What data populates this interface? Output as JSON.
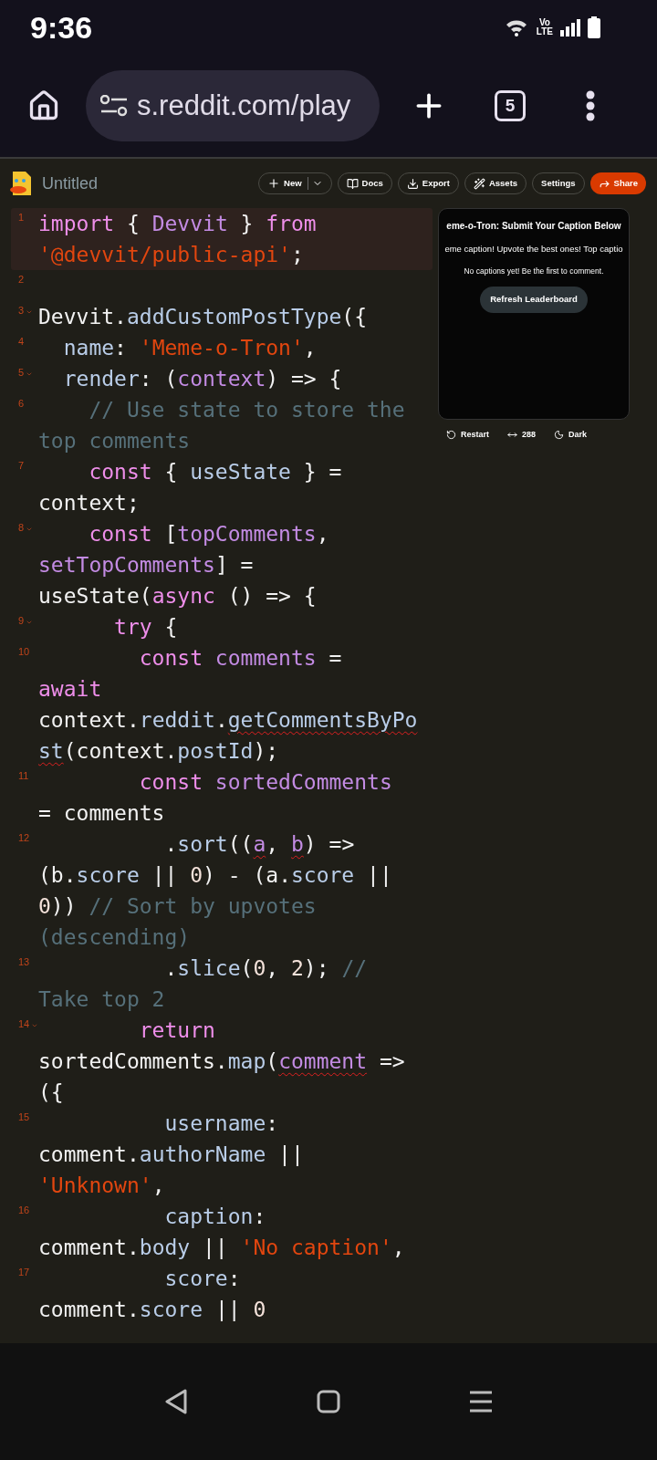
{
  "status_bar": {
    "time": "9:36",
    "network_top": "Vo",
    "network_bottom": "LTE"
  },
  "browser": {
    "url": "s.reddit.com/play",
    "tab_count": "5"
  },
  "app_bar": {
    "title": "Untitled",
    "buttons": [
      {
        "label": "New",
        "kind": "new"
      },
      {
        "label": "Docs",
        "kind": "docs"
      },
      {
        "label": "Export",
        "kind": "export"
      },
      {
        "label": "Assets",
        "kind": "assets"
      },
      {
        "label": "Settings",
        "kind": "settings"
      },
      {
        "label": "Share",
        "kind": "share"
      }
    ]
  },
  "editor": {
    "lines": [
      {
        "number": "1",
        "foldable": false,
        "highlighted": true,
        "wrapped_lines": [
          {
            "segments": [
              {
                "text": "import",
                "kind": "keyword"
              },
              {
                "text": " { ",
                "kind": "plain"
              },
              {
                "text": "Devvit",
                "kind": "variable"
              },
              {
                "text": " } ",
                "kind": "plain"
              },
              {
                "text": "from",
                "kind": "keyword"
              }
            ]
          },
          {
            "segments": [
              {
                "text": "'@devvit/public-api'",
                "kind": "string"
              },
              {
                "text": ";",
                "kind": "plain"
              }
            ]
          }
        ]
      },
      {
        "number": "2",
        "foldable": false,
        "highlighted": false
      },
      {
        "number": "3",
        "foldable": true,
        "highlighted": false,
        "wrapped_lines": [
          {
            "segments": [
              {
                "text": "Devvit.",
                "kind": "plain"
              },
              {
                "text": "addCustomPostType",
                "kind": "property"
              },
              {
                "text": "({",
                "kind": "plain"
              }
            ]
          }
        ]
      },
      {
        "number": "4",
        "foldable": false,
        "highlighted": false,
        "wrapped_lines": [
          {
            "segments": [
              {
                "text": "  name",
                "kind": "property"
              },
              {
                "text": ": ",
                "kind": "plain"
              },
              {
                "text": "'Meme-o-Tron'",
                "kind": "string"
              },
              {
                "text": ",",
                "kind": "plain"
              }
            ]
          }
        ]
      },
      {
        "number": "5",
        "foldable": true,
        "highlighted": false,
        "wrapped_lines": [
          {
            "segments": [
              {
                "text": "  render",
                "kind": "property"
              },
              {
                "text": ": (",
                "kind": "plain"
              },
              {
                "text": "context",
                "kind": "variable"
              },
              {
                "text": ") => {",
                "kind": "plain"
              }
            ]
          }
        ]
      },
      {
        "number": "6",
        "foldable": false,
        "highlighted": false,
        "wrapped_lines": [
          {
            "segments": [
              {
                "text": "    // Use state to store the",
                "kind": "comment"
              }
            ]
          },
          {
            "segments": [
              {
                "text": "top comments",
                "kind": "comment"
              }
            ]
          }
        ]
      },
      {
        "number": "7",
        "foldable": false,
        "highlighted": false,
        "wrapped_lines": [
          {
            "segments": [
              {
                "text": "    const",
                "kind": "keyword"
              },
              {
                "text": " { ",
                "kind": "plain"
              },
              {
                "text": "useState",
                "kind": "property"
              },
              {
                "text": " } =",
                "kind": "plain"
              }
            ]
          },
          {
            "segments": [
              {
                "text": "context;",
                "kind": "plain"
              }
            ]
          }
        ]
      },
      {
        "number": "8",
        "foldable": true,
        "highlighted": false,
        "wrapped_lines": [
          {
            "segments": [
              {
                "text": "    const",
                "kind": "keyword"
              },
              {
                "text": " [",
                "kind": "plain"
              },
              {
                "text": "topComments",
                "kind": "variable"
              },
              {
                "text": ",",
                "kind": "plain"
              }
            ]
          },
          {
            "segments": [
              {
                "text": "setTopComments",
                "kind": "variable"
              },
              {
                "text": "] =",
                "kind": "plain"
              }
            ]
          },
          {
            "segments": [
              {
                "text": "useState(",
                "kind": "plain"
              },
              {
                "text": "async",
                "kind": "keyword"
              },
              {
                "text": " () => {",
                "kind": "plain"
              }
            ]
          }
        ]
      },
      {
        "number": "9",
        "foldable": true,
        "highlighted": false,
        "wrapped_lines": [
          {
            "segments": [
              {
                "text": "      try",
                "kind": "keyword"
              },
              {
                "text": " {",
                "kind": "plain"
              }
            ]
          }
        ]
      },
      {
        "number": "10",
        "foldable": false,
        "highlighted": false,
        "wrapped_lines": [
          {
            "segments": [
              {
                "text": "        const",
                "kind": "keyword"
              },
              {
                "text": " comments",
                "kind": "variable"
              },
              {
                "text": " =",
                "kind": "plain"
              }
            ]
          },
          {
            "segments": [
              {
                "text": "await",
                "kind": "keyword"
              }
            ]
          },
          {
            "segments": [
              {
                "text": "context.",
                "kind": "plain"
              },
              {
                "text": "reddit",
                "kind": "property"
              },
              {
                "text": ".",
                "kind": "plain"
              },
              {
                "text": "getCommentsByPo",
                "kind": "property",
                "underlined": true
              }
            ]
          },
          {
            "segments": [
              {
                "text": "st",
                "kind": "property",
                "underlined": true
              },
              {
                "text": "(context.",
                "kind": "plain"
              },
              {
                "text": "postId",
                "kind": "property"
              },
              {
                "text": ");",
                "kind": "plain"
              }
            ]
          }
        ]
      },
      {
        "number": "11",
        "foldable": false,
        "highlighted": false,
        "wrapped_lines": [
          {
            "segments": [
              {
                "text": "        const",
                "kind": "keyword"
              },
              {
                "text": " sortedComments",
                "kind": "variable"
              }
            ]
          },
          {
            "segments": [
              {
                "text": "= comments",
                "kind": "plain"
              }
            ]
          }
        ]
      },
      {
        "number": "12",
        "foldable": false,
        "highlighted": false,
        "wrapped_lines": [
          {
            "segments": [
              {
                "text": "          .",
                "kind": "plain"
              },
              {
                "text": "sort",
                "kind": "property"
              },
              {
                "text": "((",
                "kind": "plain"
              },
              {
                "text": "a",
                "kind": "variable",
                "underlined": true
              },
              {
                "text": ", ",
                "kind": "plain"
              },
              {
                "text": "b",
                "kind": "variable",
                "underlined": true
              },
              {
                "text": ") =>",
                "kind": "plain"
              }
            ]
          },
          {
            "segments": [
              {
                "text": "(b.",
                "kind": "plain"
              },
              {
                "text": "score",
                "kind": "property"
              },
              {
                "text": " || ",
                "kind": "plain"
              },
              {
                "text": "0",
                "kind": "number"
              },
              {
                "text": ") - (a.",
                "kind": "plain"
              },
              {
                "text": "score",
                "kind": "property"
              },
              {
                "text": " ||",
                "kind": "plain"
              }
            ]
          },
          {
            "segments": [
              {
                "text": "0",
                "kind": "number"
              },
              {
                "text": ")) ",
                "kind": "plain"
              },
              {
                "text": "// Sort by upvotes",
                "kind": "comment"
              }
            ]
          },
          {
            "segments": [
              {
                "text": "(descending)",
                "kind": "comment"
              }
            ]
          }
        ]
      },
      {
        "number": "13",
        "foldable": false,
        "highlighted": false,
        "wrapped_lines": [
          {
            "segments": [
              {
                "text": "          .",
                "kind": "plain"
              },
              {
                "text": "slice",
                "kind": "property"
              },
              {
                "text": "(",
                "kind": "plain"
              },
              {
                "text": "0",
                "kind": "number"
              },
              {
                "text": ", ",
                "kind": "plain"
              },
              {
                "text": "2",
                "kind": "number"
              },
              {
                "text": "); ",
                "kind": "plain"
              },
              {
                "text": "//",
                "kind": "comment"
              }
            ]
          },
          {
            "segments": [
              {
                "text": "Take top 2",
                "kind": "comment"
              }
            ]
          }
        ]
      },
      {
        "number": "14",
        "foldable": true,
        "highlighted": false,
        "wrapped_lines": [
          {
            "segments": [
              {
                "text": "        return",
                "kind": "keyword"
              }
            ]
          },
          {
            "segments": [
              {
                "text": "sortedComments.",
                "kind": "plain"
              },
              {
                "text": "map",
                "kind": "property"
              },
              {
                "text": "(",
                "kind": "plain"
              },
              {
                "text": "comment",
                "kind": "variable",
                "underlined": true
              },
              {
                "text": " =>",
                "kind": "plain"
              }
            ]
          },
          {
            "segments": [
              {
                "text": "({",
                "kind": "plain"
              }
            ]
          }
        ]
      },
      {
        "number": "15",
        "foldable": false,
        "highlighted": false,
        "wrapped_lines": [
          {
            "segments": [
              {
                "text": "          username",
                "kind": "property"
              },
              {
                "text": ":",
                "kind": "plain"
              }
            ]
          },
          {
            "segments": [
              {
                "text": "comment.",
                "kind": "plain"
              },
              {
                "text": "authorName",
                "kind": "property"
              },
              {
                "text": " ||",
                "kind": "plain"
              }
            ]
          },
          {
            "segments": [
              {
                "text": "'Unknown'",
                "kind": "string"
              },
              {
                "text": ",",
                "kind": "plain"
              }
            ]
          }
        ]
      },
      {
        "number": "16",
        "foldable": false,
        "highlighted": false,
        "wrapped_lines": [
          {
            "segments": [
              {
                "text": "          caption",
                "kind": "property"
              },
              {
                "text": ":",
                "kind": "plain"
              }
            ]
          },
          {
            "segments": [
              {
                "text": "comment.",
                "kind": "plain"
              },
              {
                "text": "body",
                "kind": "property"
              },
              {
                "text": " || ",
                "kind": "plain"
              },
              {
                "text": "'No caption'",
                "kind": "string"
              },
              {
                "text": ",",
                "kind": "plain"
              }
            ]
          }
        ]
      },
      {
        "number": "17",
        "foldable": false,
        "highlighted": false,
        "wrapped_lines": [
          {
            "segments": [
              {
                "text": "          score",
                "kind": "property"
              },
              {
                "text": ":",
                "kind": "plain"
              }
            ]
          },
          {
            "segments": [
              {
                "text": "comment.",
                "kind": "plain"
              },
              {
                "text": "score",
                "kind": "property"
              },
              {
                "text": " || ",
                "kind": "plain"
              },
              {
                "text": "0",
                "kind": "number"
              }
            ]
          }
        ]
      }
    ]
  },
  "preview": {
    "title": "eme-o-Tron: Submit Your Caption Below",
    "subtitle": "eme caption! Upvote the best ones! Top captio",
    "message": "No captions yet! Be the first to comment.",
    "button": "Refresh Leaderboard",
    "controls": [
      {
        "label": "Restart",
        "kind": "restart"
      },
      {
        "label": "288",
        "kind": "width"
      },
      {
        "label": "Dark",
        "kind": "theme"
      }
    ]
  }
}
